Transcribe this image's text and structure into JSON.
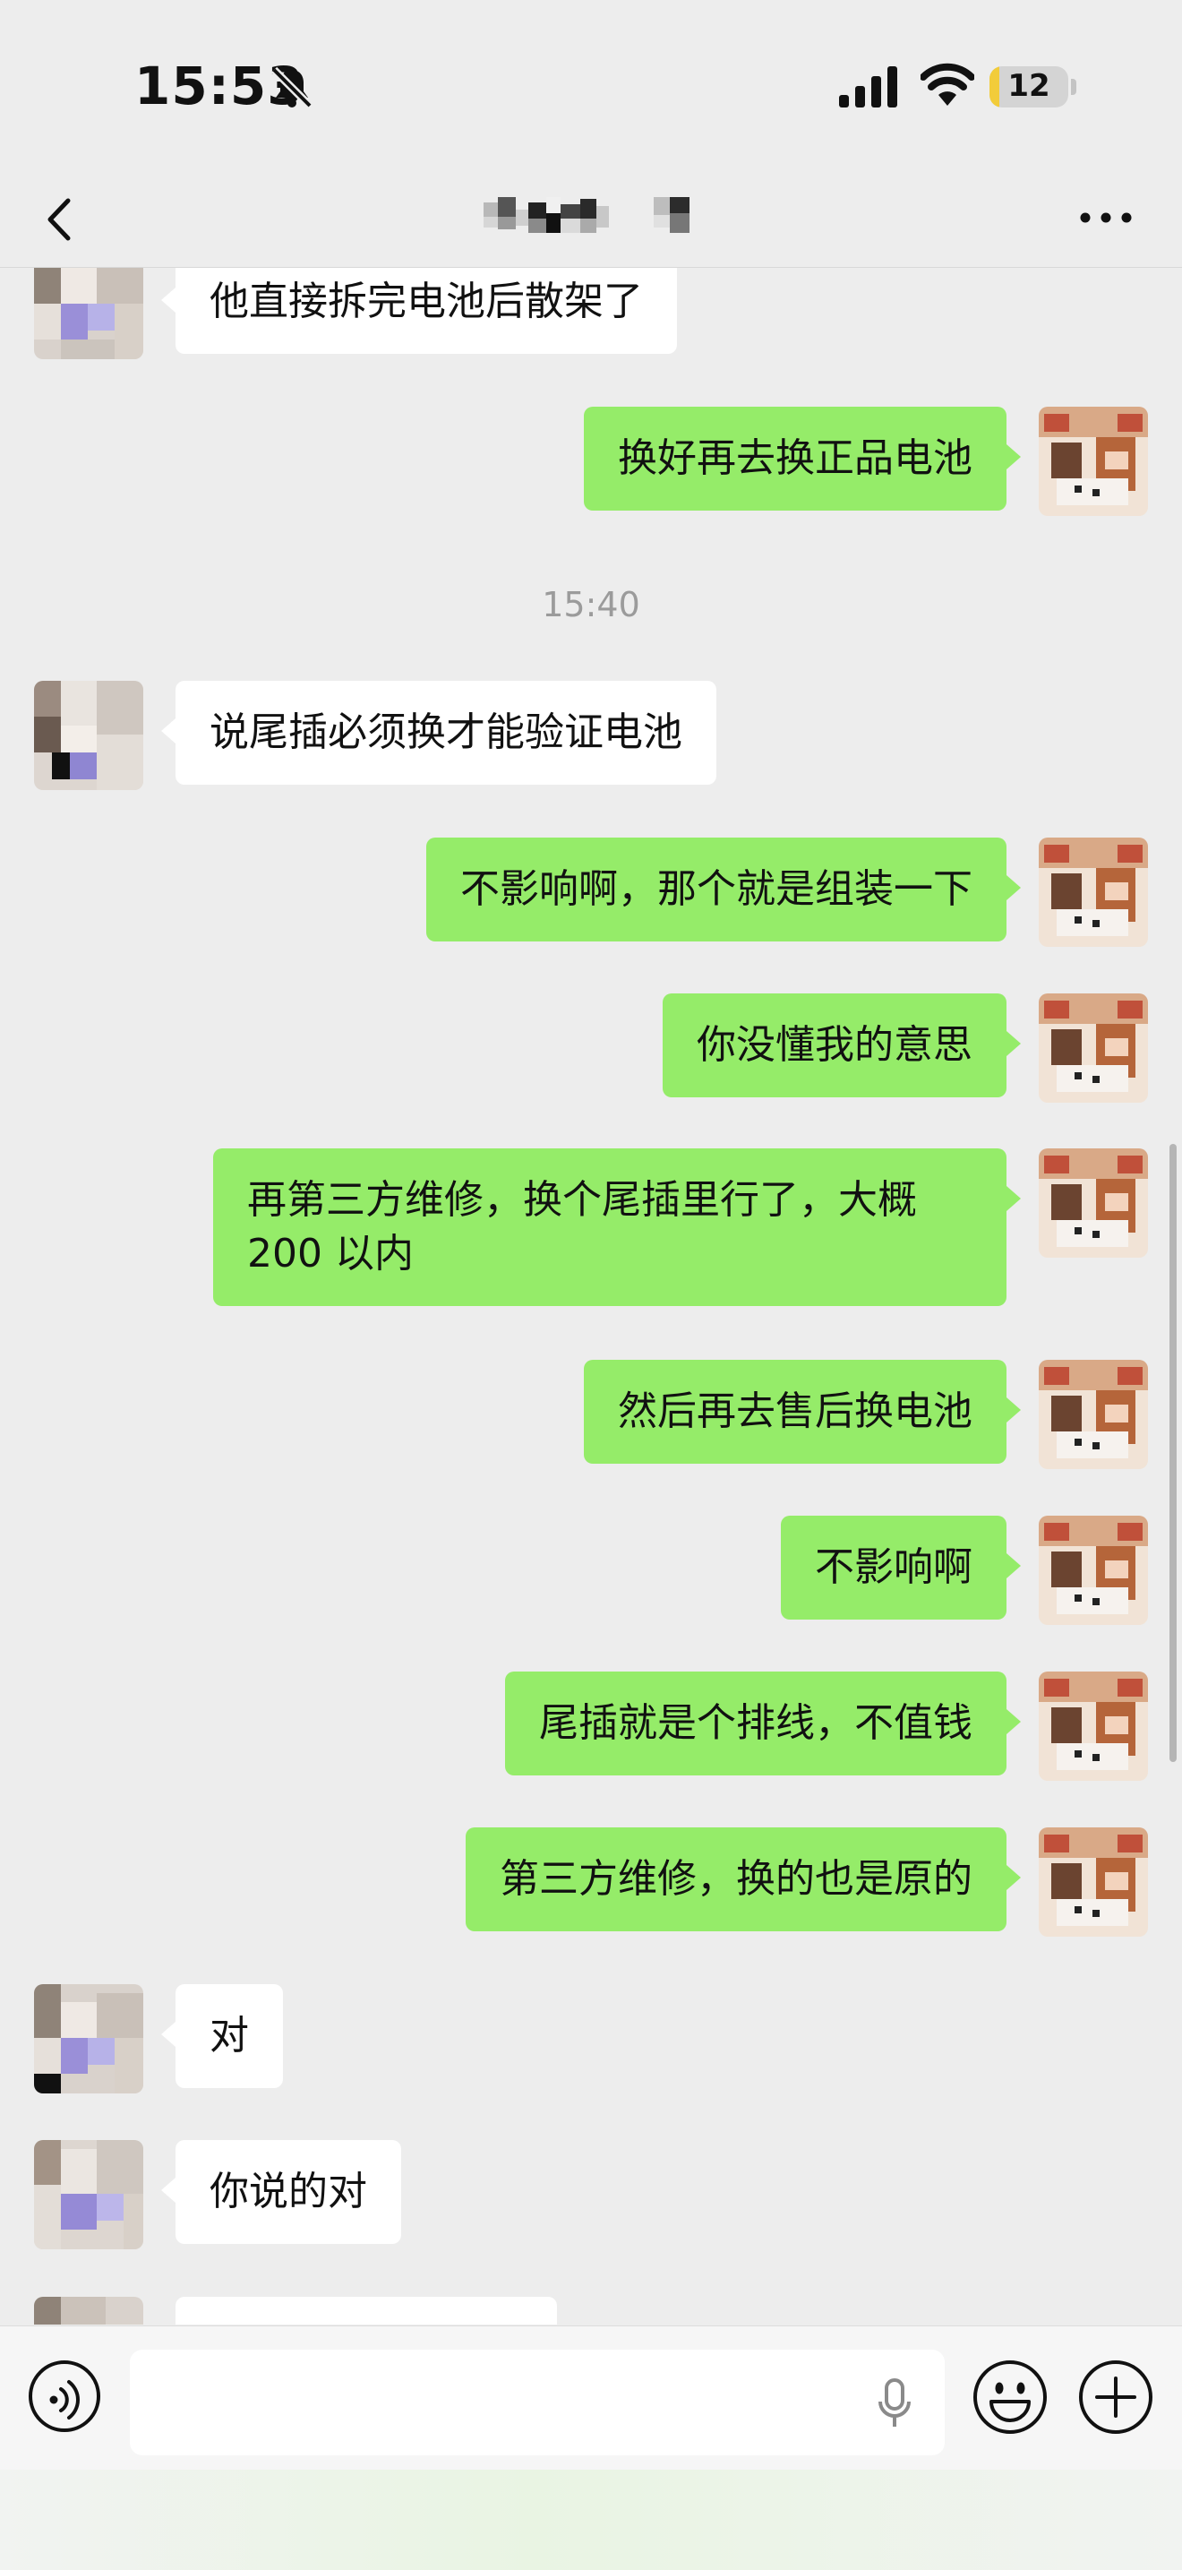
{
  "status_bar": {
    "time": "15:53",
    "battery": "12",
    "battery_level": 0.12
  },
  "header": {
    "title": ""
  },
  "messages": [
    {
      "direction": "in",
      "text": "他直接拆完电池后散架了"
    },
    {
      "direction": "out",
      "text": "换好再去换正品电池"
    },
    {
      "type": "time",
      "text": "15:40"
    },
    {
      "direction": "in",
      "text": "说尾插必须换才能验证电池"
    },
    {
      "direction": "out",
      "text": "不影响啊，那个就是组装一下"
    },
    {
      "direction": "out",
      "text": "你没懂我的意思"
    },
    {
      "direction": "out",
      "text": "再第三方维修，换个尾插里行了，大概 200 以内"
    },
    {
      "direction": "out",
      "text": "然后再去售后换电池"
    },
    {
      "direction": "out",
      "text": "不影响啊"
    },
    {
      "direction": "out",
      "text": "尾插就是个排线，不值钱"
    },
    {
      "direction": "out",
      "text": "第三方维修，换的也是原的"
    },
    {
      "direction": "in",
      "text": "对"
    },
    {
      "direction": "in",
      "text": "你说的对"
    },
    {
      "direction": "in",
      "text": ""
    }
  ],
  "input": {
    "value": "",
    "placeholder": ""
  },
  "icons": {
    "back": "chevron-left-icon",
    "more": "more-dots-icon",
    "voice": "voice-input-icon",
    "mic": "microphone-icon",
    "emoji": "emoji-icon",
    "plus": "plus-icon"
  },
  "colors": {
    "outgoing_bubble": "#95ec69",
    "incoming_bubble": "#ffffff",
    "background": "#ededed"
  }
}
